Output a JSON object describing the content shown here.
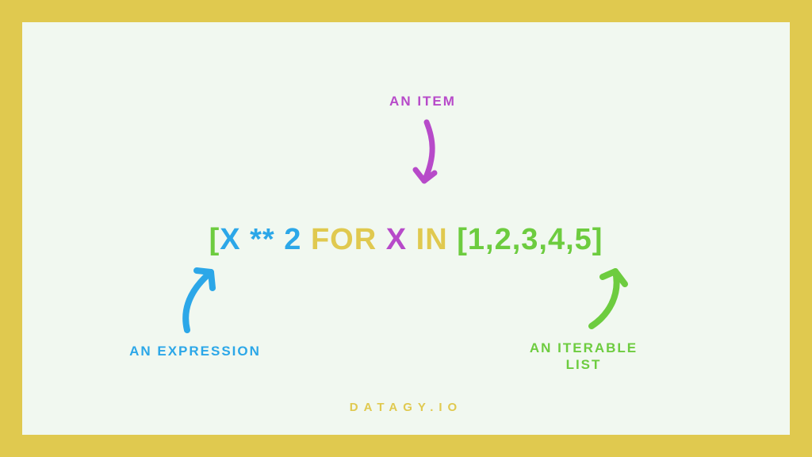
{
  "code": {
    "bracket_open": "[",
    "expr_x": "X ",
    "expr_op": "** ",
    "expr_num": "2 ",
    "for": "FOR ",
    "item_x": "X ",
    "in": "IN ",
    "list": "[1,2,3,4,5]"
  },
  "labels": {
    "item": "AN ITEM",
    "expression": "AN EXPRESSION",
    "iterable_line1": "AN ITERABLE",
    "iterable_line2": "LIST"
  },
  "footer": "DATAGY.IO",
  "colors": {
    "frame": "#e0c94f",
    "panel": "#f1f8f0",
    "green": "#6dcc3f",
    "blue": "#2ca7e8",
    "yellow": "#e0c94f",
    "purple": "#b74ac9"
  }
}
